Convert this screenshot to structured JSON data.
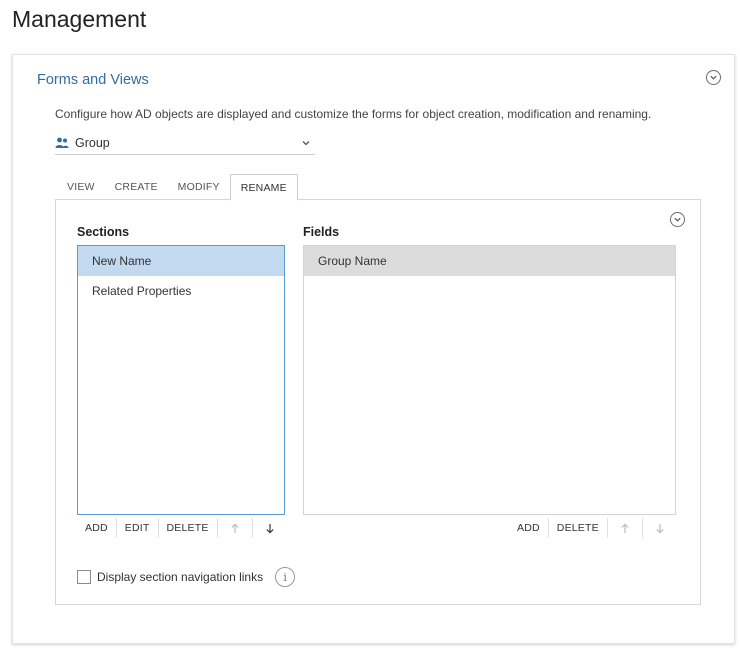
{
  "page": {
    "title": "Management"
  },
  "card": {
    "title": "Forms and Views",
    "description": "Configure how AD objects are displayed and customize the forms for object creation, modification and renaming.",
    "object_type": {
      "selected": "Group",
      "icon": "group-icon"
    }
  },
  "tabs": [
    {
      "label": "VIEW",
      "active": false
    },
    {
      "label": "CREATE",
      "active": false
    },
    {
      "label": "MODIFY",
      "active": false
    },
    {
      "label": "RENAME",
      "active": true
    }
  ],
  "sections": {
    "header": "Sections",
    "items": [
      {
        "label": "New Name",
        "selected": true
      },
      {
        "label": "Related Properties",
        "selected": false
      }
    ],
    "toolbar": {
      "add": "ADD",
      "edit": "EDIT",
      "delete": "DELETE",
      "up_icon": "arrow-up-icon",
      "down_icon": "arrow-down-icon"
    }
  },
  "fields": {
    "header": "Fields",
    "items": [
      {
        "label": "Group Name",
        "selected": true
      }
    ],
    "toolbar": {
      "add": "ADD",
      "delete": "DELETE",
      "up_icon": "arrow-up-icon",
      "down_icon": "arrow-down-icon"
    }
  },
  "options": {
    "nav_links_label": "Display section navigation links",
    "nav_links_checked": false,
    "info_glyph": "i"
  },
  "colors": {
    "accent": "#2e6da4",
    "selection": "#c3d9ef",
    "selection_border": "#5a9bd5",
    "field_selection": "#dcdcdc"
  }
}
